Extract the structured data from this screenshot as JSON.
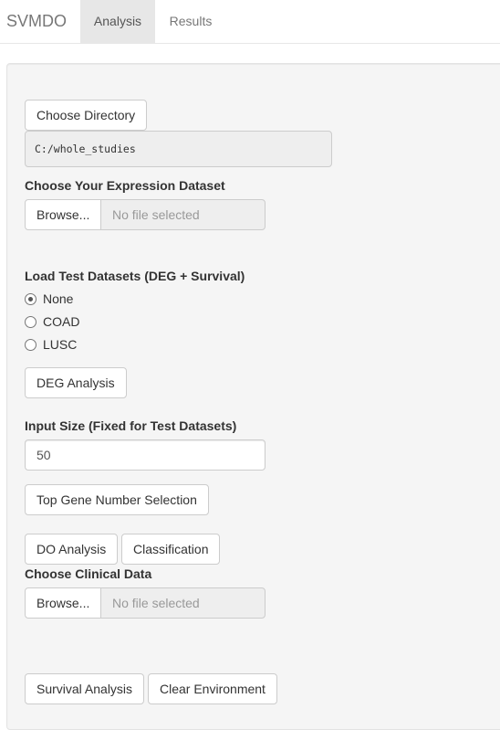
{
  "navbar": {
    "brand": "SVMDO",
    "tabs": [
      {
        "label": "Analysis",
        "active": true
      },
      {
        "label": "Results",
        "active": false
      }
    ]
  },
  "panel": {
    "choose_directory_button": "Choose Directory",
    "directory_path": "C:/whole_studies",
    "expression_dataset": {
      "label": "Choose Your Expression Dataset",
      "browse_button": "Browse...",
      "file_placeholder": "No file selected"
    },
    "test_datasets": {
      "label": "Load Test Datasets (DEG + Survival)",
      "options": [
        {
          "label": "None",
          "checked": true
        },
        {
          "label": "COAD",
          "checked": false
        },
        {
          "label": "LUSC",
          "checked": false
        }
      ]
    },
    "deg_analysis_button": "DEG Analysis",
    "input_size": {
      "label": "Input Size (Fixed for Test Datasets)",
      "value": "50"
    },
    "top_gene_button": "Top Gene Number Selection",
    "do_analysis_button": "DO Analysis",
    "classification_button": "Classification",
    "clinical_data": {
      "label": "Choose Clinical Data",
      "browse_button": "Browse...",
      "file_placeholder": "No file selected"
    },
    "survival_analysis_button": "Survival Analysis",
    "clear_environment_button": "Clear Environment"
  },
  "colors": {
    "navbar_active_bg": "#e7e7e7",
    "well_bg": "#f5f5f5",
    "border": "#cccccc",
    "text": "#333333",
    "muted_text": "#999999"
  }
}
